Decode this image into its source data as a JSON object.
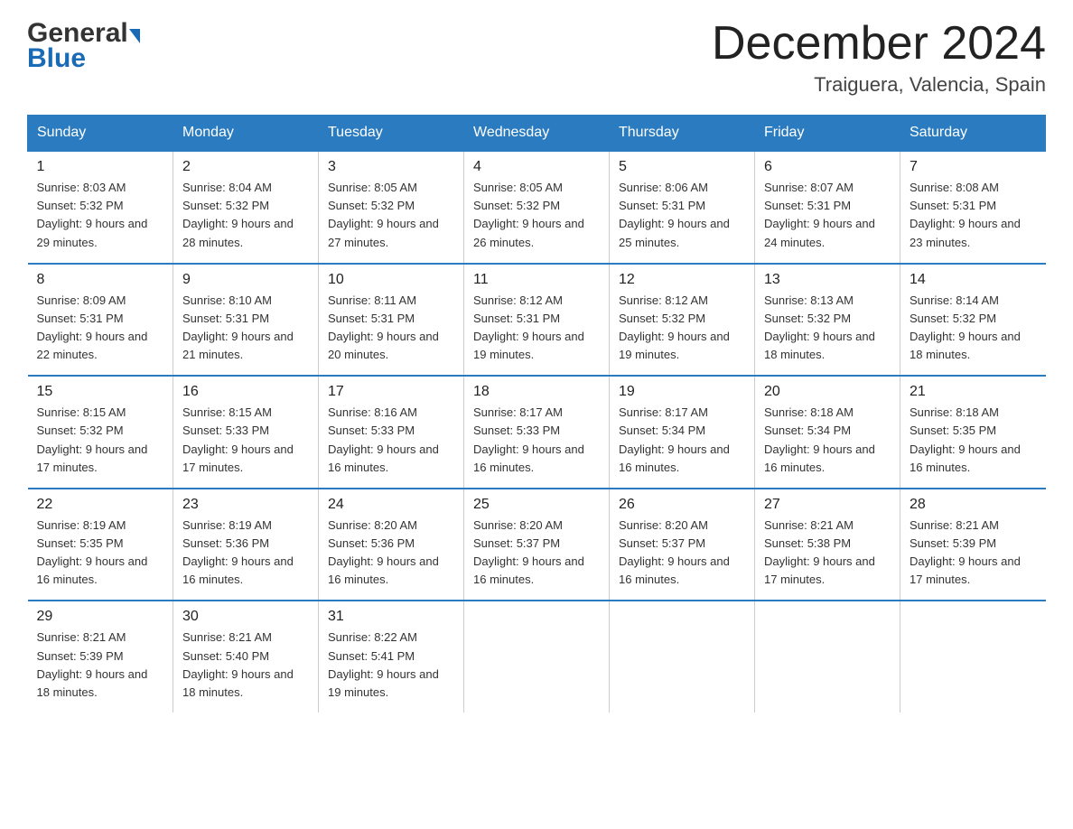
{
  "header": {
    "logo_general": "General",
    "logo_blue": "Blue",
    "month_title": "December 2024",
    "location": "Traiguera, Valencia, Spain"
  },
  "weekdays": [
    "Sunday",
    "Monday",
    "Tuesday",
    "Wednesday",
    "Thursday",
    "Friday",
    "Saturday"
  ],
  "weeks": [
    [
      {
        "day": "1",
        "sunrise": "8:03 AM",
        "sunset": "5:32 PM",
        "daylight": "9 hours and 29 minutes."
      },
      {
        "day": "2",
        "sunrise": "8:04 AM",
        "sunset": "5:32 PM",
        "daylight": "9 hours and 28 minutes."
      },
      {
        "day": "3",
        "sunrise": "8:05 AM",
        "sunset": "5:32 PM",
        "daylight": "9 hours and 27 minutes."
      },
      {
        "day": "4",
        "sunrise": "8:05 AM",
        "sunset": "5:32 PM",
        "daylight": "9 hours and 26 minutes."
      },
      {
        "day": "5",
        "sunrise": "8:06 AM",
        "sunset": "5:31 PM",
        "daylight": "9 hours and 25 minutes."
      },
      {
        "day": "6",
        "sunrise": "8:07 AM",
        "sunset": "5:31 PM",
        "daylight": "9 hours and 24 minutes."
      },
      {
        "day": "7",
        "sunrise": "8:08 AM",
        "sunset": "5:31 PM",
        "daylight": "9 hours and 23 minutes."
      }
    ],
    [
      {
        "day": "8",
        "sunrise": "8:09 AM",
        "sunset": "5:31 PM",
        "daylight": "9 hours and 22 minutes."
      },
      {
        "day": "9",
        "sunrise": "8:10 AM",
        "sunset": "5:31 PM",
        "daylight": "9 hours and 21 minutes."
      },
      {
        "day": "10",
        "sunrise": "8:11 AM",
        "sunset": "5:31 PM",
        "daylight": "9 hours and 20 minutes."
      },
      {
        "day": "11",
        "sunrise": "8:12 AM",
        "sunset": "5:31 PM",
        "daylight": "9 hours and 19 minutes."
      },
      {
        "day": "12",
        "sunrise": "8:12 AM",
        "sunset": "5:32 PM",
        "daylight": "9 hours and 19 minutes."
      },
      {
        "day": "13",
        "sunrise": "8:13 AM",
        "sunset": "5:32 PM",
        "daylight": "9 hours and 18 minutes."
      },
      {
        "day": "14",
        "sunrise": "8:14 AM",
        "sunset": "5:32 PM",
        "daylight": "9 hours and 18 minutes."
      }
    ],
    [
      {
        "day": "15",
        "sunrise": "8:15 AM",
        "sunset": "5:32 PM",
        "daylight": "9 hours and 17 minutes."
      },
      {
        "day": "16",
        "sunrise": "8:15 AM",
        "sunset": "5:33 PM",
        "daylight": "9 hours and 17 minutes."
      },
      {
        "day": "17",
        "sunrise": "8:16 AM",
        "sunset": "5:33 PM",
        "daylight": "9 hours and 16 minutes."
      },
      {
        "day": "18",
        "sunrise": "8:17 AM",
        "sunset": "5:33 PM",
        "daylight": "9 hours and 16 minutes."
      },
      {
        "day": "19",
        "sunrise": "8:17 AM",
        "sunset": "5:34 PM",
        "daylight": "9 hours and 16 minutes."
      },
      {
        "day": "20",
        "sunrise": "8:18 AM",
        "sunset": "5:34 PM",
        "daylight": "9 hours and 16 minutes."
      },
      {
        "day": "21",
        "sunrise": "8:18 AM",
        "sunset": "5:35 PM",
        "daylight": "9 hours and 16 minutes."
      }
    ],
    [
      {
        "day": "22",
        "sunrise": "8:19 AM",
        "sunset": "5:35 PM",
        "daylight": "9 hours and 16 minutes."
      },
      {
        "day": "23",
        "sunrise": "8:19 AM",
        "sunset": "5:36 PM",
        "daylight": "9 hours and 16 minutes."
      },
      {
        "day": "24",
        "sunrise": "8:20 AM",
        "sunset": "5:36 PM",
        "daylight": "9 hours and 16 minutes."
      },
      {
        "day": "25",
        "sunrise": "8:20 AM",
        "sunset": "5:37 PM",
        "daylight": "9 hours and 16 minutes."
      },
      {
        "day": "26",
        "sunrise": "8:20 AM",
        "sunset": "5:37 PM",
        "daylight": "9 hours and 16 minutes."
      },
      {
        "day": "27",
        "sunrise": "8:21 AM",
        "sunset": "5:38 PM",
        "daylight": "9 hours and 17 minutes."
      },
      {
        "day": "28",
        "sunrise": "8:21 AM",
        "sunset": "5:39 PM",
        "daylight": "9 hours and 17 minutes."
      }
    ],
    [
      {
        "day": "29",
        "sunrise": "8:21 AM",
        "sunset": "5:39 PM",
        "daylight": "9 hours and 18 minutes."
      },
      {
        "day": "30",
        "sunrise": "8:21 AM",
        "sunset": "5:40 PM",
        "daylight": "9 hours and 18 minutes."
      },
      {
        "day": "31",
        "sunrise": "8:22 AM",
        "sunset": "5:41 PM",
        "daylight": "9 hours and 19 minutes."
      },
      null,
      null,
      null,
      null
    ]
  ],
  "labels": {
    "sunrise_prefix": "Sunrise: ",
    "sunset_prefix": "Sunset: ",
    "daylight_prefix": "Daylight: "
  }
}
